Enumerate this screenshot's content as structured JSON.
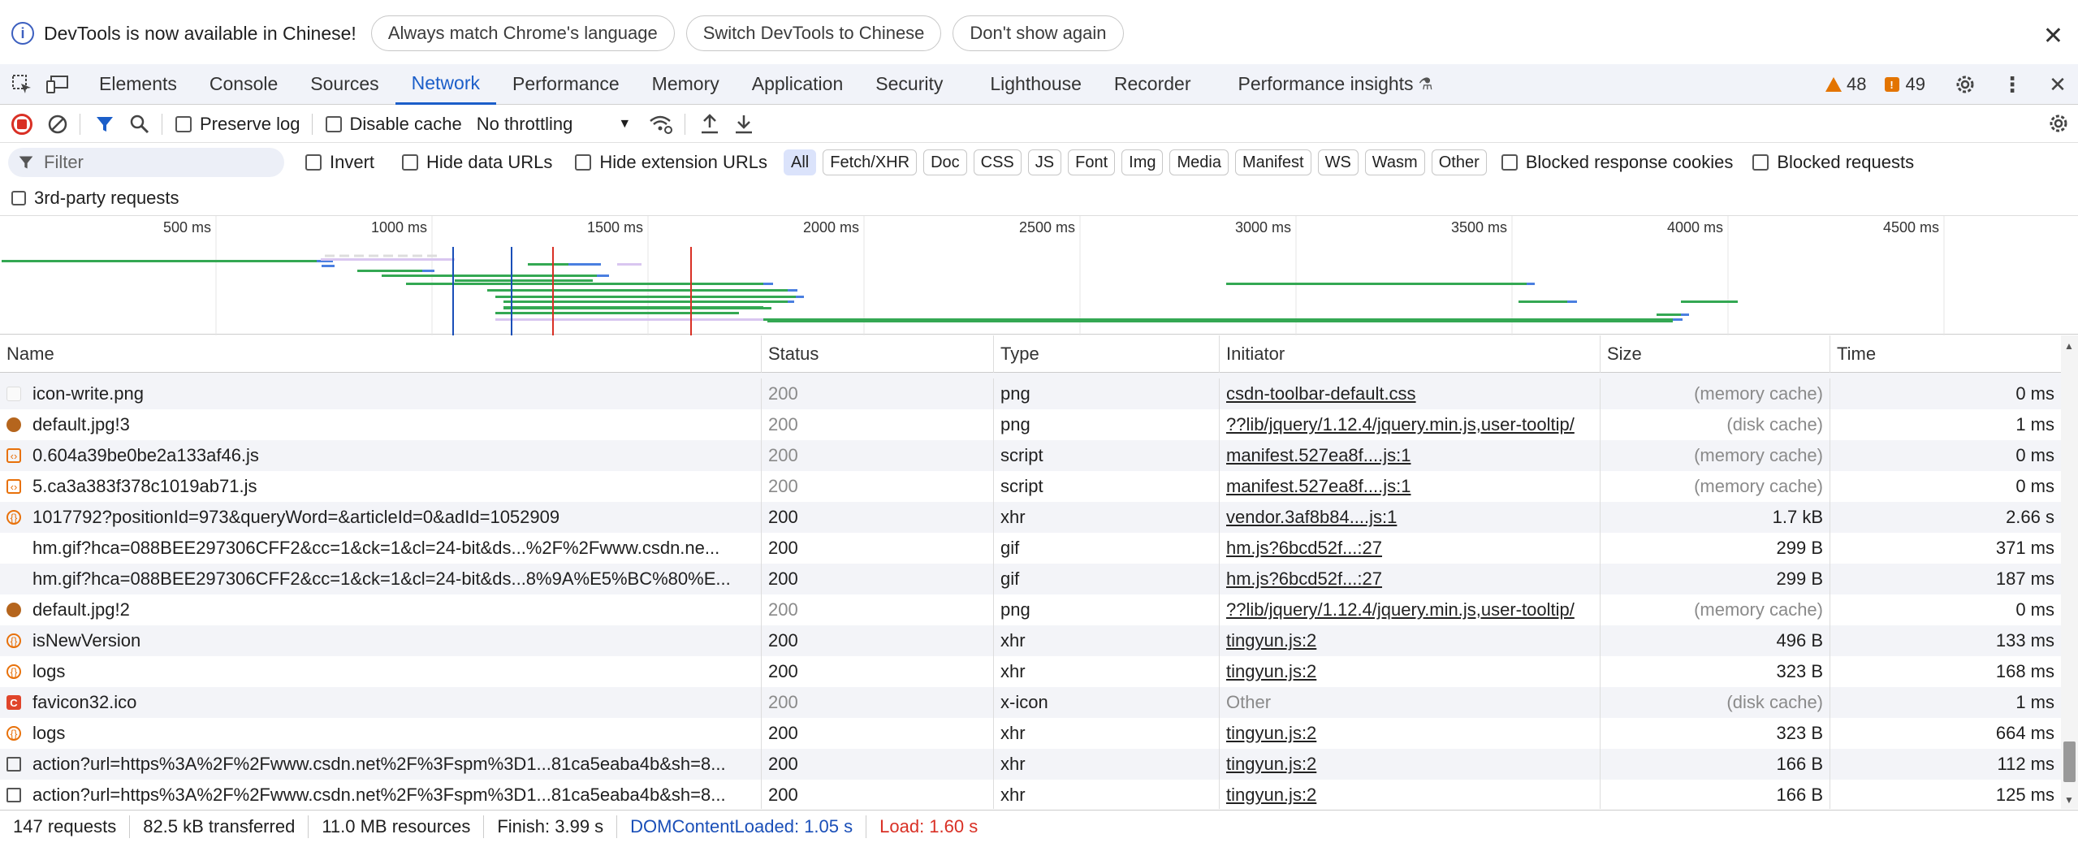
{
  "infobar": {
    "message": "DevTools is now available in Chinese!",
    "btn_match": "Always match Chrome's language",
    "btn_switch": "Switch DevTools to Chinese",
    "btn_dont_show": "Don't show again"
  },
  "tabs": [
    "Elements",
    "Console",
    "Sources",
    "Network",
    "Performance",
    "Memory",
    "Application",
    "Security",
    "Lighthouse",
    "Recorder",
    "Performance insights"
  ],
  "active_tab": "Network",
  "warnings_count": "48",
  "issues_count": "49",
  "toolbar": {
    "preserve_log": "Preserve log",
    "disable_cache": "Disable cache",
    "throttling": "No throttling"
  },
  "filter": {
    "placeholder": "Filter",
    "invert": "Invert",
    "hide_data_urls": "Hide data URLs",
    "hide_extension_urls": "Hide extension URLs",
    "types": [
      "All",
      "Fetch/XHR",
      "Doc",
      "CSS",
      "JS",
      "Font",
      "Img",
      "Media",
      "Manifest",
      "WS",
      "Wasm",
      "Other"
    ],
    "blocked_response_cookies": "Blocked response cookies",
    "blocked_requests": "Blocked requests",
    "third_party": "3rd-party requests"
  },
  "overview": {
    "ticks": [
      "500 ms",
      "1000 ms",
      "1500 ms",
      "2000 ms",
      "2500 ms",
      "3000 ms",
      "3500 ms",
      "4000 ms",
      "4500 ms"
    ]
  },
  "table": {
    "headers": [
      "Name",
      "Status",
      "Type",
      "Initiator",
      "Size",
      "Time"
    ],
    "rows": [
      {
        "name": "icon-write.png",
        "status": "200",
        "type": "png",
        "initiator": "csdn-toolbar-default.css",
        "size": "(memory cache)",
        "time": "0 ms",
        "icon": "image-icon",
        "dim": true
      },
      {
        "name": "default.jpg!3",
        "status": "200",
        "type": "png",
        "initiator": "??lib/jquery/1.12.4/jquery.min.js,user-tooltip/",
        "size": "(disk cache)",
        "time": "1 ms",
        "icon": "avatar-image-icon",
        "dim": true
      },
      {
        "name": "0.604a39be0be2a133af46.js",
        "status": "200",
        "type": "script",
        "initiator": "manifest.527ea8f....js:1",
        "size": "(memory cache)",
        "time": "0 ms",
        "icon": "script-icon",
        "dim": true
      },
      {
        "name": "5.ca3a383f378c1019ab71.js",
        "status": "200",
        "type": "script",
        "initiator": "manifest.527ea8f....js:1",
        "size": "(memory cache)",
        "time": "0 ms",
        "icon": "script-icon",
        "dim": true
      },
      {
        "name": "1017792?positionId=973&queryWord=&articleId=0&adId=1052909",
        "status": "200",
        "type": "xhr",
        "initiator": "vendor.3af8b84....js:1",
        "size": "1.7 kB",
        "time": "2.66 s",
        "icon": "xhr-icon",
        "dim": false
      },
      {
        "name": "hm.gif?hca=088BEE297306CFF2&cc=1&ck=1&cl=24-bit&ds...%2F%2Fwww.csdn.ne...",
        "status": "200",
        "type": "gif",
        "initiator": "hm.js?6bcd52f...:27",
        "size": "299 B",
        "time": "371 ms",
        "icon": "blank",
        "dim": false
      },
      {
        "name": "hm.gif?hca=088BEE297306CFF2&cc=1&ck=1&cl=24-bit&ds...8%9A%E5%BC%80%E...",
        "status": "200",
        "type": "gif",
        "initiator": "hm.js?6bcd52f...:27",
        "size": "299 B",
        "time": "187 ms",
        "icon": "blank",
        "dim": false
      },
      {
        "name": "default.jpg!2",
        "status": "200",
        "type": "png",
        "initiator": "??lib/jquery/1.12.4/jquery.min.js,user-tooltip/",
        "size": "(memory cache)",
        "time": "0 ms",
        "icon": "avatar-image-icon",
        "dim": true
      },
      {
        "name": "isNewVersion",
        "status": "200",
        "type": "xhr",
        "initiator": "tingyun.js:2",
        "size": "496 B",
        "time": "133 ms",
        "icon": "xhr-icon",
        "dim": false
      },
      {
        "name": "logs",
        "status": "200",
        "type": "xhr",
        "initiator": "tingyun.js:2",
        "size": "323 B",
        "time": "168 ms",
        "icon": "xhr-icon",
        "dim": false
      },
      {
        "name": "favicon32.ico",
        "status": "200",
        "type": "x-icon",
        "initiator": "Other",
        "size": "(disk cache)",
        "time": "1 ms",
        "icon": "favicon-icon",
        "dim": true
      },
      {
        "name": "logs",
        "status": "200",
        "type": "xhr",
        "initiator": "tingyun.js:2",
        "size": "323 B",
        "time": "664 ms",
        "icon": "xhr-icon",
        "dim": false
      },
      {
        "name": "action?url=https%3A%2F%2Fwww.csdn.net%2F%3Fspm%3D1...81ca5eaba4b&sh=8...",
        "status": "200",
        "type": "xhr",
        "initiator": "tingyun.js:2",
        "size": "166 B",
        "time": "112 ms",
        "icon": "document-icon",
        "dim": false
      },
      {
        "name": "action?url=https%3A%2F%2Fwww.csdn.net%2F%3Fspm%3D1...81ca5eaba4b&sh=8...",
        "status": "200",
        "type": "xhr",
        "initiator": "tingyun.js:2",
        "size": "166 B",
        "time": "125 ms",
        "icon": "document-icon",
        "dim": false
      }
    ]
  },
  "statusbar": {
    "requests": "147 requests",
    "transferred": "82.5 kB transferred",
    "resources": "11.0 MB resources",
    "finish": "Finish: 3.99 s",
    "dom_content_loaded": "DOMContentLoaded: 1.05 s",
    "load": "Load: 1.60 s"
  },
  "colors": {
    "accent": "#1b5ec9",
    "record": "#d93025",
    "dcl": "#1a4fb8",
    "load": "#d93025",
    "bar_green": "#34a853",
    "bar_blue": "#4a7fe0"
  }
}
